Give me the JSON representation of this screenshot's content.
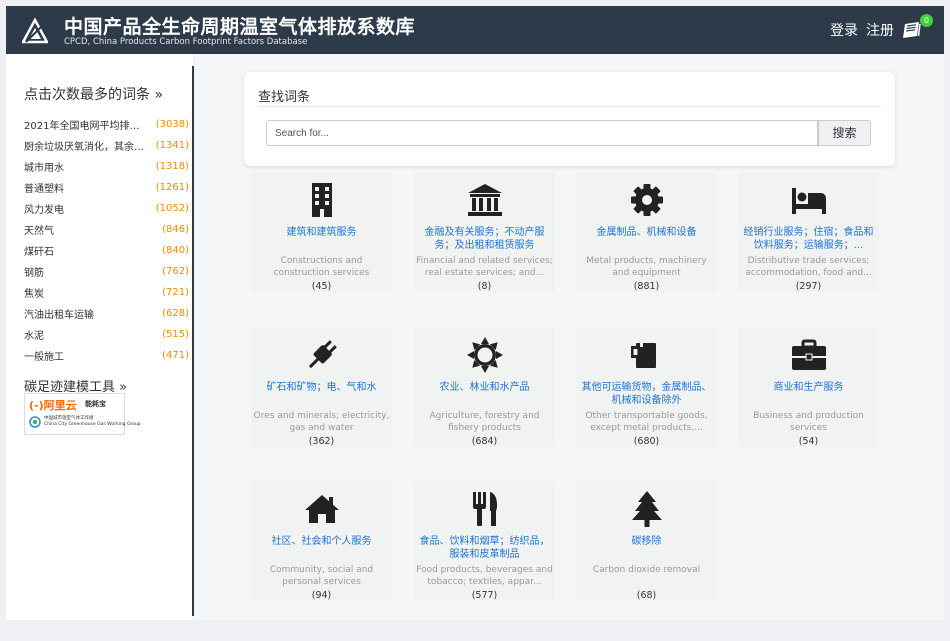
{
  "header": {
    "title": "中国产品全生命周期温室气体排放系数库",
    "subtitle": "CPCD, China Products Carbon Footprint Factors Database",
    "login": "登录",
    "register": "注册",
    "cart_count": "0",
    "bg_color": "#2d3a4a"
  },
  "sidebar": {
    "heading": "点击次数最多的词条 »",
    "items": [
      {
        "name": "2021年全国电网平均排放...",
        "count": "(3038)"
      },
      {
        "name": "厨余垃圾厌氧消化，其余垃...",
        "count": "(1341)"
      },
      {
        "name": "城市用水",
        "count": "(1318)"
      },
      {
        "name": "普通塑料",
        "count": "(1261)"
      },
      {
        "name": "风力发电",
        "count": "(1052)"
      },
      {
        "name": "天然气",
        "count": "(846)"
      },
      {
        "name": "煤矸石",
        "count": "(840)"
      },
      {
        "name": "钢筋",
        "count": "(762)"
      },
      {
        "name": "焦炭",
        "count": "(721)"
      },
      {
        "name": "汽油出租车运输",
        "count": "(628)"
      },
      {
        "name": "水泥",
        "count": "(515)"
      },
      {
        "name": "一般施工",
        "count": "(471)"
      }
    ],
    "tools_heading": "碳足迹建模工具 »",
    "aliyun_logo": "(-)阿里云",
    "aliyun_sub": "能耗宝",
    "city_logo_line1": "中国城市温室气体工作组",
    "city_logo_line2": "China City Greenhouse Gas Working Group",
    "count_color": "#f08c00"
  },
  "search": {
    "title": "查找词条",
    "placeholder": "Search for...",
    "button": "搜索"
  },
  "categories": [
    {
      "icon": "building-icon",
      "name": "建筑和建筑服务",
      "en": "Constructions and construction services",
      "count": "(45)"
    },
    {
      "icon": "bank-icon",
      "name": "金融及有关服务；不动产服务；及出租和租赁服务",
      "en": "Financial and related services; real estate services; and...",
      "count": "(8)"
    },
    {
      "icon": "gear-icon",
      "name": "金属制品、机械和设备",
      "en": "Metal products, machinery and equipment",
      "count": "(881)"
    },
    {
      "icon": "bed-icon",
      "name": "经销行业服务；住宿；食品和饮料服务；运输服务；...",
      "en": "Distributive trade services; accommodation, food and...",
      "count": "(297)"
    },
    {
      "icon": "plug-icon",
      "name": "矿石和矿物；电、气和水",
      "en": "Ores and minerals; electricity, gas and water",
      "count": "(362)"
    },
    {
      "icon": "sun-icon",
      "name": "农业、林业和水产品",
      "en": "Agriculture, forestry and fishery products",
      "count": "(684)"
    },
    {
      "icon": "mug-icon",
      "name": "其他可运输货物，金属制品、机械和设备除外",
      "en": "Other transportable goods, except metal products,...",
      "count": "(680)"
    },
    {
      "icon": "briefcase-icon",
      "name": "商业和生产服务",
      "en": "Business and production services",
      "count": "(54)"
    },
    {
      "icon": "home-icon",
      "name": "社区、社会和个人服务",
      "en": "Community, social and personal services",
      "count": "(94)"
    },
    {
      "icon": "cutlery-icon",
      "name": "食品、饮料和烟草；纺织品，服装和皮革制品",
      "en": "Food products, beverages and tobacco; textiles, appar...",
      "count": "(577)"
    },
    {
      "icon": "tree-icon",
      "name": "碳移除",
      "en": "Carbon dioxide removal",
      "count": "(68)"
    }
  ],
  "colors": {
    "link": "#1a73d6",
    "icon": "#222222",
    "card_bg": "#f1f3f2"
  }
}
